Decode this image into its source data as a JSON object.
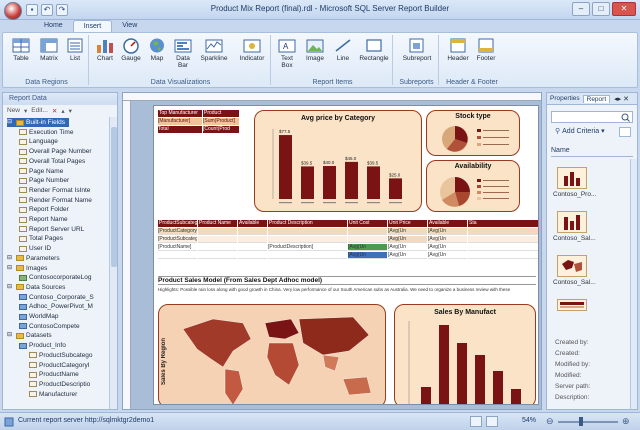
{
  "window": {
    "title": "Product Mix Report (final).rdl - Microsoft SQL Server Report Builder"
  },
  "tabs": [
    "Home",
    "Insert",
    "View"
  ],
  "ribbon": {
    "groups": [
      {
        "label": "Data Regions",
        "buttons": [
          "Table",
          "Matrix",
          "List"
        ]
      },
      {
        "label": "Data Visualizations",
        "buttons": [
          "Chart",
          "Gauge",
          "Map",
          "Data Bar",
          "Sparkline",
          "Indicator"
        ]
      },
      {
        "label": "Report Items",
        "buttons": [
          "Text Box",
          "Image",
          "Line",
          "Rectangle"
        ]
      },
      {
        "label": "Subreports",
        "buttons": [
          "Subreport"
        ]
      },
      {
        "label": "Header & Footer",
        "buttons": [
          "Header",
          "Footer"
        ]
      }
    ]
  },
  "left_panel": {
    "title": "Report Data",
    "toolbar": [
      "New",
      "Edit..."
    ],
    "tree": [
      {
        "label": "Built-in Fields",
        "level": 0,
        "type": "folder",
        "selected": true
      },
      {
        "label": "Execution Time",
        "level": 1,
        "type": "field"
      },
      {
        "label": "Language",
        "level": 1,
        "type": "field"
      },
      {
        "label": "Overall Page Number",
        "level": 1,
        "type": "field"
      },
      {
        "label": "Overall Total Pages",
        "level": 1,
        "type": "field"
      },
      {
        "label": "Page Name",
        "level": 1,
        "type": "field"
      },
      {
        "label": "Page Number",
        "level": 1,
        "type": "field"
      },
      {
        "label": "Render Format IsInte",
        "level": 1,
        "type": "field"
      },
      {
        "label": "Render Format Name",
        "level": 1,
        "type": "field"
      },
      {
        "label": "Report Folder",
        "level": 1,
        "type": "field"
      },
      {
        "label": "Report Name",
        "level": 1,
        "type": "field"
      },
      {
        "label": "Report Server URL",
        "level": 1,
        "type": "field"
      },
      {
        "label": "Total Pages",
        "level": 1,
        "type": "field"
      },
      {
        "label": "User ID",
        "level": 1,
        "type": "field"
      },
      {
        "label": "Parameters",
        "level": 0,
        "type": "folder"
      },
      {
        "label": "Images",
        "level": 0,
        "type": "folder"
      },
      {
        "label": "ContosocorporateLog",
        "level": 1,
        "type": "img"
      },
      {
        "label": "Data Sources",
        "level": 0,
        "type": "folder"
      },
      {
        "label": "Contoso_Corporate_S",
        "level": 1,
        "type": "tbl"
      },
      {
        "label": "Adhoc_PowerPivot_M",
        "level": 1,
        "type": "tbl"
      },
      {
        "label": "WorldMap",
        "level": 1,
        "type": "tbl"
      },
      {
        "label": "ContosoCompete",
        "level": 1,
        "type": "tbl"
      },
      {
        "label": "Datasets",
        "level": 0,
        "type": "folder"
      },
      {
        "label": "Product_Info",
        "level": 1,
        "type": "tbl"
      },
      {
        "label": "ProductSubcatego",
        "level": 2,
        "type": "field"
      },
      {
        "label": "ProductCategoryI",
        "level": 2,
        "type": "field"
      },
      {
        "label": "ProductName",
        "level": 2,
        "type": "field"
      },
      {
        "label": "ProductDescriptio",
        "level": 2,
        "type": "field"
      },
      {
        "label": "Manufacturer",
        "level": 2,
        "type": "field"
      }
    ]
  },
  "report": {
    "top_table": {
      "headers": [
        "Top Manufacturer",
        "Product"
      ],
      "rows": [
        [
          "[Manufacturer]",
          "[Sum(Product]"
        ],
        [
          "Total",
          "[Count(Prod"
        ]
      ]
    },
    "avg_price": {
      "title": "Avg price by Category",
      "value_labels": [
        "$77.5",
        "$39.5",
        "$40.0",
        "$45.0",
        "$39.5",
        "$25.0"
      ]
    },
    "stock_type": {
      "title": "Stock type"
    },
    "availability": {
      "title": "Availability"
    },
    "product_table": {
      "headers": [
        "ProductSubcategory",
        "Product Name",
        "Available",
        "Product Description",
        "Unit Cost",
        "Unit Price",
        "Available",
        "Sta"
      ],
      "rows": [
        [
          "[ProductCategoryName]",
          "",
          "",
          "",
          "",
          "[Avg(Un",
          "[Avg(Un",
          ""
        ],
        [
          "[ProductSubcategory]",
          "",
          "",
          "",
          "",
          "[Avg(Un",
          "[Avg(Un",
          ""
        ],
        [
          "[ProductName]",
          "",
          "",
          "[ProductDescription]",
          "[Avg(Un",
          "[Avg(Un",
          "[Avg(Un",
          ""
        ],
        [
          "",
          "",
          "",
          "",
          "[Avg(Un",
          "[Avg(Un",
          "[Avg(Un",
          ""
        ]
      ]
    },
    "sales_model_title": "Product Sales Model (From Sales Dept Adhoc model)",
    "highlights": "Highlights: Possible rain loss along with good growth in China. Very low performance of our South American subs as Australia. We need to organize a business review with these",
    "sales_by_region": {
      "axis_label": "Sales By Region"
    },
    "sales_by_manufacturer": {
      "title": "Sales By Manufact"
    }
  },
  "right_panel": {
    "tabs": [
      "Properties",
      "Report"
    ],
    "add_criteria": "Add Criteria",
    "name_header": "Name",
    "parts": [
      "Contoso_Pro...",
      "Contoso_Sal...",
      "Contoso_Sal..."
    ],
    "props": [
      "Created by:",
      "Created:",
      "Modified by:",
      "Modified:",
      "Server path:",
      "Description:"
    ]
  },
  "status": {
    "text": "Current report server http://sqlmktgr2demo1",
    "zoom": "54%",
    "zoom_level": 0.54
  }
}
